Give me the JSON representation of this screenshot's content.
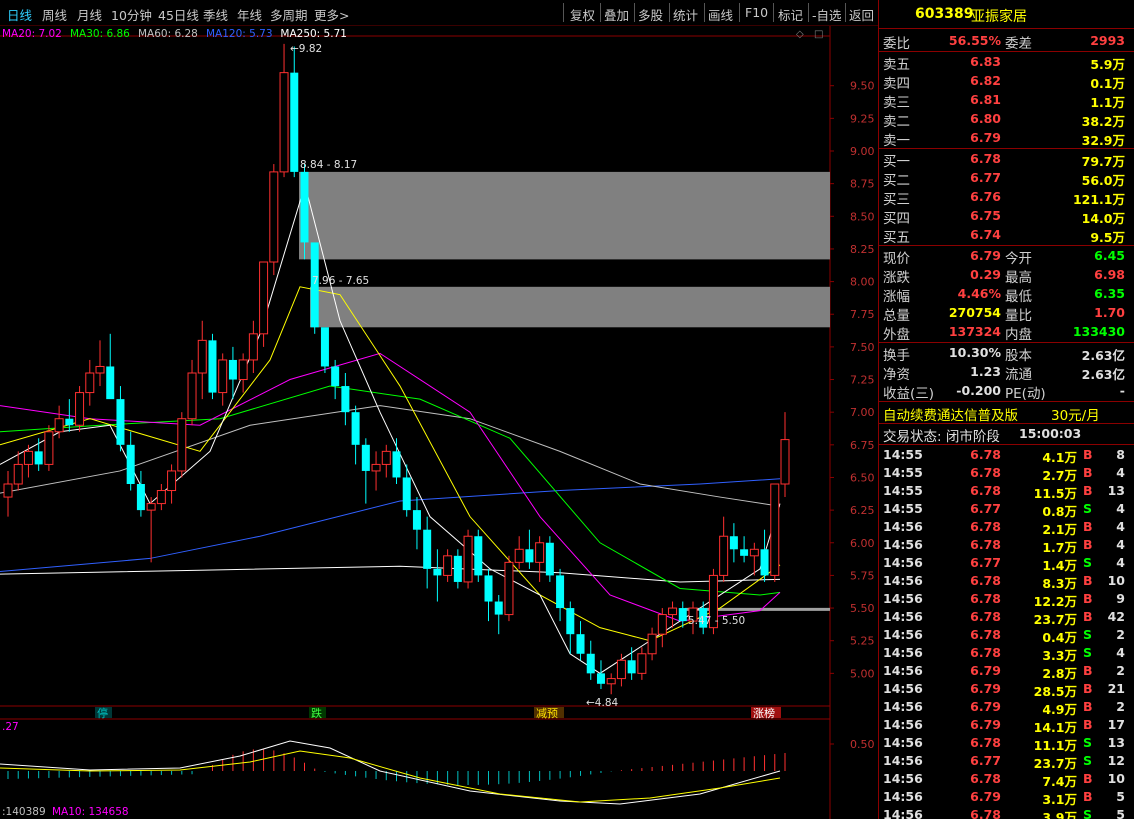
{
  "toolbar": {
    "left_items": [
      "日线",
      "周线",
      "月线",
      "10分钟",
      "45日线",
      "季线",
      "年线",
      "多周期",
      "更多>"
    ],
    "right_items": [
      "复权",
      "叠加",
      "多股",
      "统计",
      "画线",
      "F10",
      "标记",
      "-自选",
      "返回"
    ]
  },
  "ma_legend": [
    {
      "text": "MA20: 7.02",
      "color": "#ff00ff"
    },
    {
      "text": "MA30: 6.86",
      "color": "#00ff00"
    },
    {
      "text": "MA60: 6.28",
      "color": "#c0c0c0"
    },
    {
      "text": "MA120: 5.73",
      "color": "#3060ff"
    },
    {
      "text": "MA250: 5.71",
      "color": "#ffffff"
    }
  ],
  "price_axis": [
    "9.50",
    "9.25",
    "9.00",
    "8.75",
    "8.50",
    "8.25",
    "8.00",
    "7.75",
    "7.50",
    "7.25",
    "7.00",
    "6.75",
    "6.50",
    "6.25",
    "6.00",
    "5.75",
    "5.50",
    "5.25",
    "5.00"
  ],
  "vol_axis": [
    "0.50"
  ],
  "annotations": {
    "high": "9.82",
    "low": "4.84",
    "zone1": "8.84 - 8.17",
    "zone2": "7.96 - 7.65",
    "zone3": "5.47 - 5.50"
  },
  "event_tags": [
    {
      "text": "停",
      "color": "#00c0c0",
      "bg": "#003838"
    },
    {
      "text": "跌",
      "color": "#40ff40",
      "bg": "#003800"
    },
    {
      "text": "减预",
      "color": "#ffe000",
      "bg": "#503000"
    },
    {
      "text": "涨榜",
      "color": "#ffffff",
      "bg": "#a01010"
    }
  ],
  "subchart_label": ".27",
  "bottom_legend": {
    "vol": "140389",
    "ma10": "MA10: 134658"
  },
  "stock": {
    "code": "603389",
    "name": "亚振家居"
  },
  "quote": {
    "weibi_label": "委比",
    "weibi": "56.55%",
    "weicha_label": "委差",
    "weicha": "2993",
    "asks": [
      {
        "label": "卖五",
        "price": "6.83",
        "vol": "5.9万"
      },
      {
        "label": "卖四",
        "price": "6.82",
        "vol": "0.1万"
      },
      {
        "label": "卖三",
        "price": "6.81",
        "vol": "1.1万"
      },
      {
        "label": "卖二",
        "price": "6.80",
        "vol": "38.2万"
      },
      {
        "label": "卖一",
        "price": "6.79",
        "vol": "32.9万"
      }
    ],
    "bids": [
      {
        "label": "买一",
        "price": "6.78",
        "vol": "79.7万"
      },
      {
        "label": "买二",
        "price": "6.77",
        "vol": "56.0万"
      },
      {
        "label": "买三",
        "price": "6.76",
        "vol": "121.1万"
      },
      {
        "label": "买四",
        "price": "6.75",
        "vol": "14.0万"
      },
      {
        "label": "买五",
        "price": "6.74",
        "vol": "9.5万"
      }
    ],
    "stats": [
      {
        "l1": "现价",
        "v1": "6.79",
        "c1": "#ff4040",
        "l2": "今开",
        "v2": "6.45",
        "c2": "#00ff00"
      },
      {
        "l1": "涨跌",
        "v1": "0.29",
        "c1": "#ff4040",
        "l2": "最高",
        "v2": "6.98",
        "c2": "#ff4040"
      },
      {
        "l1": "涨幅",
        "v1": "4.46%",
        "c1": "#ff4040",
        "l2": "最低",
        "v2": "6.35",
        "c2": "#00ff00"
      },
      {
        "l1": "总量",
        "v1": "270754",
        "c1": "#ffff00",
        "l2": "量比",
        "v2": "1.70",
        "c2": "#ff4040"
      },
      {
        "l1": "外盘",
        "v1": "137324",
        "c1": "#ff4040",
        "l2": "内盘",
        "v2": "133430",
        "c2": "#00ff00"
      }
    ],
    "stats2": [
      {
        "l1": "换手",
        "v1": "10.30%",
        "c1": "#e0e0e0",
        "l2": "股本",
        "v2": "2.63亿",
        "c2": "#e0e0e0"
      },
      {
        "l1": "净资",
        "v1": "1.23",
        "c1": "#e0e0e0",
        "l2": "流通",
        "v2": "2.63亿",
        "c2": "#e0e0e0"
      },
      {
        "l1": "收益(三)",
        "v1": "-0.200",
        "c1": "#e0e0e0",
        "l2": "PE(动)",
        "v2": "-",
        "c2": "#e0e0e0"
      }
    ]
  },
  "promo": {
    "text": "自动续费通达信普及版",
    "price": "30元/月"
  },
  "trade_status": {
    "label": "交易状态: 闭市阶段",
    "time": "15:00:03"
  },
  "ticks": [
    {
      "t": "14:55",
      "p": "6.78",
      "v": "4.1万",
      "d": "B",
      "n": "8"
    },
    {
      "t": "14:55",
      "p": "6.78",
      "v": "2.7万",
      "d": "B",
      "n": "4"
    },
    {
      "t": "14:55",
      "p": "6.78",
      "v": "11.5万",
      "d": "B",
      "n": "13"
    },
    {
      "t": "14:55",
      "p": "6.77",
      "v": "0.8万",
      "d": "S",
      "n": "4"
    },
    {
      "t": "14:56",
      "p": "6.78",
      "v": "2.1万",
      "d": "B",
      "n": "4"
    },
    {
      "t": "14:56",
      "p": "6.78",
      "v": "1.7万",
      "d": "B",
      "n": "4"
    },
    {
      "t": "14:56",
      "p": "6.77",
      "v": "1.4万",
      "d": "S",
      "n": "4"
    },
    {
      "t": "14:56",
      "p": "6.78",
      "v": "8.3万",
      "d": "B",
      "n": "10"
    },
    {
      "t": "14:56",
      "p": "6.78",
      "v": "12.2万",
      "d": "B",
      "n": "9"
    },
    {
      "t": "14:56",
      "p": "6.78",
      "v": "23.7万",
      "d": "B",
      "n": "42"
    },
    {
      "t": "14:56",
      "p": "6.78",
      "v": "0.4万",
      "d": "S",
      "n": "2"
    },
    {
      "t": "14:56",
      "p": "6.78",
      "v": "3.3万",
      "d": "S",
      "n": "4"
    },
    {
      "t": "14:56",
      "p": "6.79",
      "v": "2.8万",
      "d": "B",
      "n": "2"
    },
    {
      "t": "14:56",
      "p": "6.79",
      "v": "28.5万",
      "d": "B",
      "n": "21"
    },
    {
      "t": "14:56",
      "p": "6.79",
      "v": "4.9万",
      "d": "B",
      "n": "2"
    },
    {
      "t": "14:56",
      "p": "6.79",
      "v": "14.1万",
      "d": "B",
      "n": "17"
    },
    {
      "t": "14:56",
      "p": "6.78",
      "v": "11.1万",
      "d": "S",
      "n": "13"
    },
    {
      "t": "14:56",
      "p": "6.77",
      "v": "23.7万",
      "d": "S",
      "n": "12"
    },
    {
      "t": "14:56",
      "p": "6.78",
      "v": "7.4万",
      "d": "B",
      "n": "10"
    },
    {
      "t": "14:56",
      "p": "6.79",
      "v": "3.1万",
      "d": "B",
      "n": "5"
    },
    {
      "t": "14:56",
      "p": "6.78",
      "v": "3.9万",
      "d": "S",
      "n": "5"
    }
  ],
  "chart_data": {
    "type": "candlestick",
    "price_range": [
      4.75,
      9.85
    ],
    "candles": [
      [
        6.35,
        6.55,
        6.2,
        6.45
      ],
      [
        6.45,
        6.7,
        6.4,
        6.6
      ],
      [
        6.6,
        6.75,
        6.5,
        6.7
      ],
      [
        6.7,
        6.8,
        6.55,
        6.6
      ],
      [
        6.6,
        6.9,
        6.55,
        6.85
      ],
      [
        6.85,
        7.05,
        6.8,
        6.95
      ],
      [
        6.95,
        7.1,
        6.85,
        6.9
      ],
      [
        6.9,
        7.2,
        6.85,
        7.15
      ],
      [
        7.15,
        7.4,
        7.05,
        7.3
      ],
      [
        7.3,
        7.55,
        7.2,
        7.35
      ],
      [
        7.35,
        7.6,
        7.2,
        7.1
      ],
      [
        7.1,
        7.2,
        6.7,
        6.75
      ],
      [
        6.75,
        6.85,
        6.4,
        6.45
      ],
      [
        6.45,
        6.55,
        6.2,
        6.25
      ],
      [
        6.25,
        6.35,
        5.85,
        6.3
      ],
      [
        6.3,
        6.45,
        6.25,
        6.4
      ],
      [
        6.4,
        6.6,
        6.3,
        6.55
      ],
      [
        6.55,
        7.0,
        6.5,
        6.95
      ],
      [
        6.95,
        7.4,
        6.9,
        7.3
      ],
      [
        7.3,
        7.7,
        7.1,
        7.55
      ],
      [
        7.55,
        7.6,
        7.1,
        7.15
      ],
      [
        7.15,
        7.45,
        7.05,
        7.4
      ],
      [
        7.4,
        7.5,
        7.1,
        7.25
      ],
      [
        7.25,
        7.45,
        7.15,
        7.4
      ],
      [
        7.4,
        7.7,
        7.3,
        7.6
      ],
      [
        7.6,
        8.0,
        7.5,
        8.15
      ],
      [
        8.15,
        8.9,
        8.05,
        8.84
      ],
      [
        8.84,
        9.82,
        8.8,
        9.6
      ],
      [
        9.6,
        9.8,
        8.8,
        8.84
      ],
      [
        8.84,
        8.9,
        8.17,
        8.3
      ],
      [
        8.3,
        7.96,
        7.6,
        7.65
      ],
      [
        7.65,
        7.55,
        7.3,
        7.35
      ],
      [
        7.35,
        7.4,
        7.1,
        7.2
      ],
      [
        7.2,
        7.3,
        6.9,
        7.0
      ],
      [
        7.0,
        7.05,
        6.6,
        6.75
      ],
      [
        6.75,
        6.8,
        6.3,
        6.55
      ],
      [
        6.55,
        6.7,
        6.4,
        6.6
      ],
      [
        6.6,
        6.75,
        6.5,
        6.7
      ],
      [
        6.7,
        6.8,
        6.45,
        6.5
      ],
      [
        6.5,
        6.6,
        6.2,
        6.25
      ],
      [
        6.25,
        6.35,
        5.95,
        6.1
      ],
      [
        6.1,
        6.2,
        5.65,
        5.8
      ],
      [
        5.8,
        5.95,
        5.55,
        5.75
      ],
      [
        5.75,
        5.95,
        5.7,
        5.9
      ],
      [
        5.9,
        5.95,
        5.65,
        5.7
      ],
      [
        5.7,
        6.1,
        5.65,
        6.05
      ],
      [
        6.05,
        6.1,
        5.7,
        5.75
      ],
      [
        5.75,
        5.8,
        5.4,
        5.55
      ],
      [
        5.55,
        5.6,
        5.3,
        5.45
      ],
      [
        5.45,
        5.9,
        5.4,
        5.85
      ],
      [
        5.85,
        6.05,
        5.8,
        5.95
      ],
      [
        5.95,
        6.1,
        5.8,
        5.85
      ],
      [
        5.85,
        6.05,
        5.7,
        6.0
      ],
      [
        6.0,
        6.05,
        5.7,
        5.75
      ],
      [
        5.75,
        5.8,
        5.4,
        5.5
      ],
      [
        5.5,
        5.55,
        5.15,
        5.3
      ],
      [
        5.3,
        5.4,
        5.1,
        5.15
      ],
      [
        5.15,
        5.25,
        4.95,
        5.0
      ],
      [
        5.0,
        5.1,
        4.88,
        4.92
      ],
      [
        4.92,
        5.0,
        4.84,
        4.96
      ],
      [
        4.96,
        5.15,
        4.9,
        5.1
      ],
      [
        5.1,
        5.2,
        4.95,
        5.0
      ],
      [
        5.0,
        5.2,
        4.95,
        5.15
      ],
      [
        5.15,
        5.35,
        5.1,
        5.3
      ],
      [
        5.3,
        5.5,
        5.2,
        5.45
      ],
      [
        5.45,
        5.55,
        5.35,
        5.5
      ],
      [
        5.5,
        5.55,
        5.35,
        5.4
      ],
      [
        5.4,
        5.55,
        5.3,
        5.5
      ],
      [
        5.5,
        5.55,
        5.3,
        5.35
      ],
      [
        5.35,
        5.8,
        5.3,
        5.75
      ],
      [
        5.75,
        6.2,
        5.7,
        6.05
      ],
      [
        6.05,
        6.15,
        5.85,
        5.95
      ],
      [
        5.95,
        6.05,
        5.85,
        5.9
      ],
      [
        5.9,
        6.0,
        5.75,
        5.95
      ],
      [
        5.95,
        6.1,
        5.7,
        5.75
      ],
      [
        5.75,
        6.25,
        5.7,
        6.45
      ],
      [
        6.45,
        7.0,
        6.35,
        6.79
      ]
    ],
    "ma_series": [
      {
        "name": "MA20",
        "color": "#ff00ff"
      },
      {
        "name": "MA30",
        "color": "#00ff00"
      },
      {
        "name": "MA60",
        "color": "#c0c0c0"
      },
      {
        "name": "MA120",
        "color": "#3060ff"
      },
      {
        "name": "MA250",
        "color": "#ffffff"
      }
    ]
  }
}
